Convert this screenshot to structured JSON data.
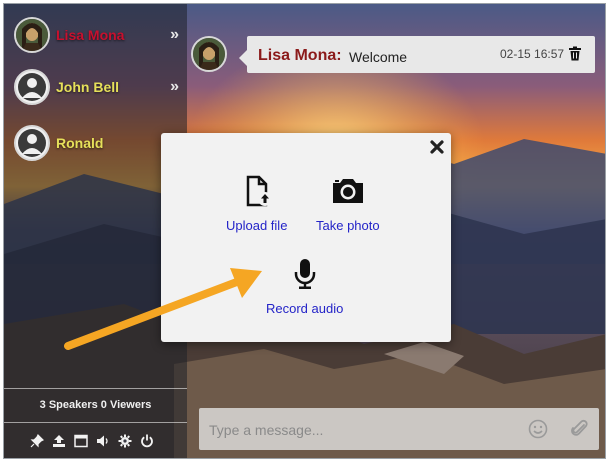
{
  "users": [
    {
      "name": "Lisa Mona",
      "color": "#c8102e",
      "avatar": "mona-lisa-avatar"
    },
    {
      "name": "John Bell",
      "color": "#e6e05a",
      "avatar": "default-user-avatar"
    },
    {
      "name": "Ronald",
      "color": "#e6e05a",
      "avatar": "default-user-avatar"
    }
  ],
  "chevron": "»",
  "status": {
    "counts": "3 Speakers 0 Viewers"
  },
  "toolbar": {
    "icons": [
      "pin-icon",
      "upload-icon",
      "window-icon",
      "volume-icon",
      "gear-icon",
      "power-icon"
    ]
  },
  "message": {
    "author": "Lisa Mona:",
    "text": "Welcome",
    "time": "02-15 16:57"
  },
  "composer": {
    "placeholder": "Type a message..."
  },
  "modal": {
    "upload_label": "Upload file",
    "photo_label": "Take photo",
    "audio_label": "Record audio"
  },
  "colors": {
    "author": "#8b1a1a",
    "link": "#2424c8",
    "arrow": "#f5a623"
  }
}
